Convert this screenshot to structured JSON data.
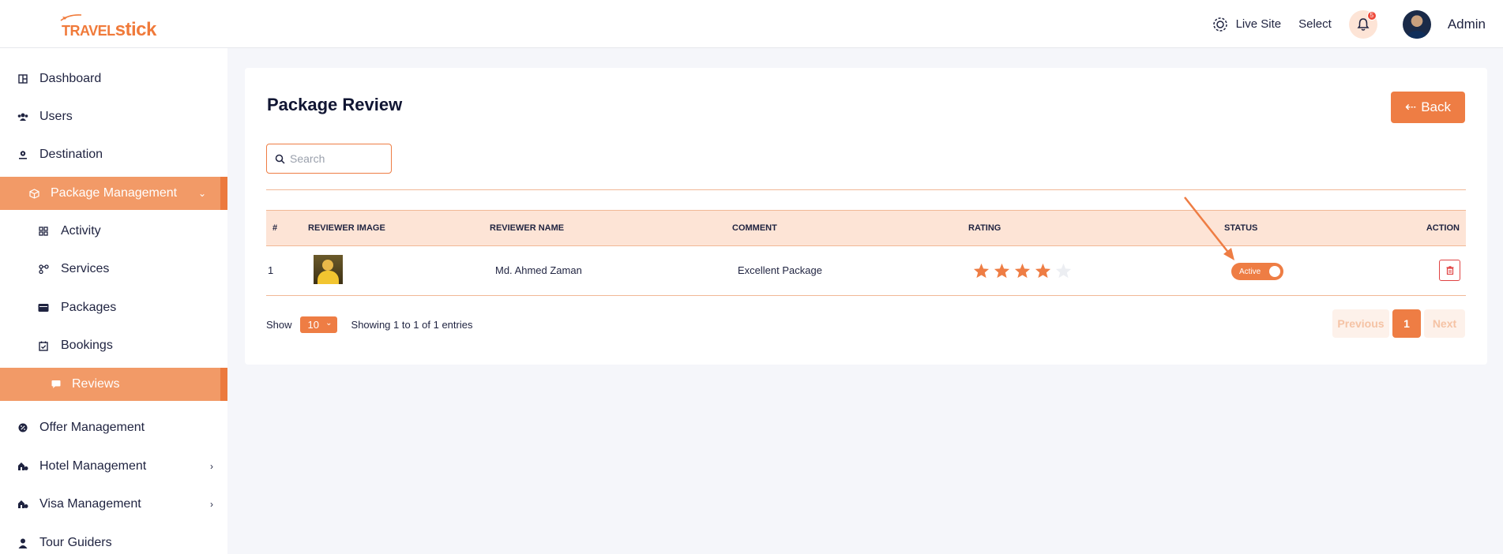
{
  "brand": {
    "logo_main": "TRAVEL",
    "logo_accent": "stick",
    "accent": "#ee7d44"
  },
  "header": {
    "live_site": "Live Site",
    "select": "Select",
    "notification_count": "5",
    "user_name": "Admin"
  },
  "sidebar": {
    "items": [
      {
        "label": "Dashboard",
        "icon": "dashboard-icon"
      },
      {
        "label": "Users",
        "icon": "users-icon"
      },
      {
        "label": "Destination",
        "icon": "map-pin-icon"
      },
      {
        "label": "Package Management",
        "icon": "box-icon",
        "expanded": true
      },
      {
        "label": "Activity",
        "icon": "grid-icon"
      },
      {
        "label": "Services",
        "icon": "services-icon"
      },
      {
        "label": "Packages",
        "icon": "wallet-icon"
      },
      {
        "label": "Bookings",
        "icon": "calendar-check-icon"
      },
      {
        "label": "Reviews",
        "icon": "chat-icon",
        "active": true
      },
      {
        "label": "Offer Management",
        "icon": "percent-icon"
      },
      {
        "label": "Hotel Management",
        "icon": "hotel-icon"
      },
      {
        "label": "Visa Management",
        "icon": "visa-icon"
      },
      {
        "label": "Tour Guiders",
        "icon": "guide-icon"
      }
    ]
  },
  "main": {
    "title": "Package Review",
    "back_label": "Back",
    "search_placeholder": "Search",
    "table": {
      "columns": [
        "#",
        "REVIEWER IMAGE",
        "REVIEWER NAME",
        "COMMENT",
        "RATING",
        "STATUS",
        "ACTION"
      ],
      "rows": [
        {
          "index": "1",
          "name": "Md. Ahmed Zaman",
          "comment": "Excellent Package",
          "rating": 4,
          "rating_max": 5,
          "status": "Active"
        }
      ]
    },
    "footer": {
      "show_label": "Show",
      "page_length": "10",
      "info": "Showing 1 to 1 of 1 entries",
      "previous": "Previous",
      "page": "1",
      "next": "Next"
    }
  }
}
